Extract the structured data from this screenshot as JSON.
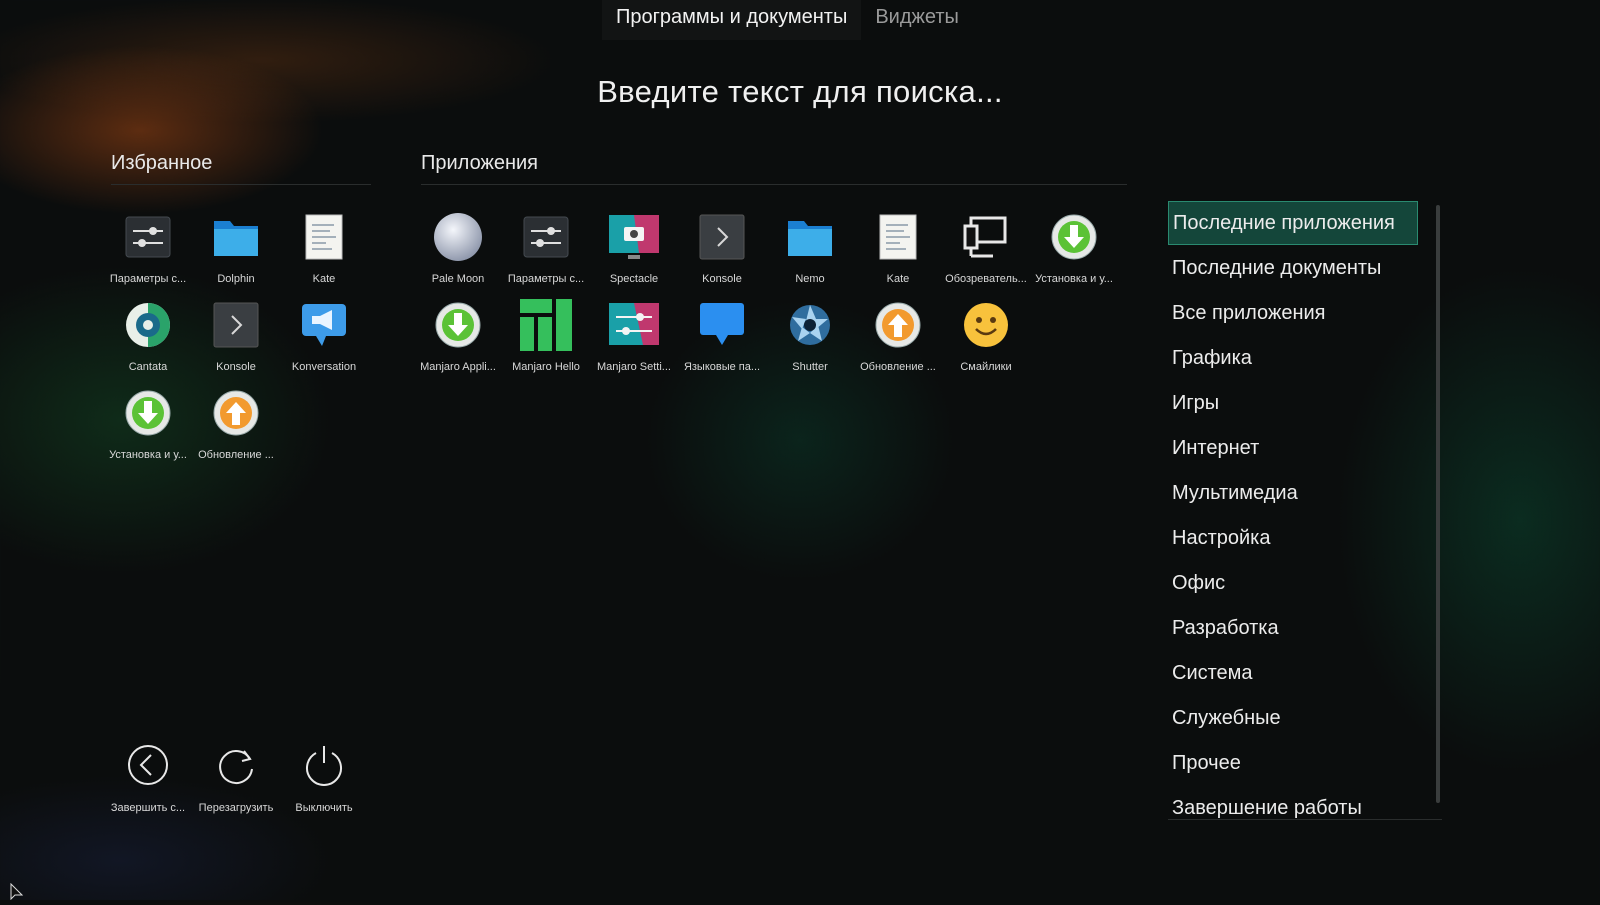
{
  "tabs": [
    {
      "label": "Программы и документы",
      "active": true
    },
    {
      "label": "Виджеты",
      "active": false
    }
  ],
  "search": {
    "placeholder": "Введите текст для поиска..."
  },
  "favorites": {
    "title": "Избранное",
    "items": [
      {
        "label": "Параметры с...",
        "icon": "settings-icon"
      },
      {
        "label": "Dolphin",
        "icon": "folder-icon"
      },
      {
        "label": "Kate",
        "icon": "text-editor-icon"
      },
      {
        "label": "Cantata",
        "icon": "music-player-icon"
      },
      {
        "label": "Konsole",
        "icon": "terminal-icon"
      },
      {
        "label": "Konversation",
        "icon": "chat-megaphone-icon"
      },
      {
        "label": "Установка и у...",
        "icon": "install-download-icon"
      },
      {
        "label": "Обновление ...",
        "icon": "update-upload-icon"
      }
    ]
  },
  "applications": {
    "title": "Приложения",
    "items": [
      {
        "label": "Pale Moon",
        "icon": "pale-moon-icon"
      },
      {
        "label": "Параметры с...",
        "icon": "settings-icon"
      },
      {
        "label": "Spectacle",
        "icon": "screenshot-icon"
      },
      {
        "label": "Konsole",
        "icon": "terminal-icon"
      },
      {
        "label": "Nemo",
        "icon": "folder-icon"
      },
      {
        "label": "Kate",
        "icon": "text-editor-icon"
      },
      {
        "label": "Обозреватель...",
        "icon": "network-icon"
      },
      {
        "label": "Установка и у...",
        "icon": "install-download-icon"
      },
      {
        "label": "Manjaro Appli...",
        "icon": "install-download-icon"
      },
      {
        "label": "Manjaro Hello",
        "icon": "manjaro-logo-icon"
      },
      {
        "label": "Manjaro Setti...",
        "icon": "manjaro-settings-icon"
      },
      {
        "label": "Языковые па...",
        "icon": "language-chat-icon"
      },
      {
        "label": "Shutter",
        "icon": "shutter-aperture-icon"
      },
      {
        "label": "Обновление ...",
        "icon": "update-upload-icon"
      },
      {
        "label": "Смайлики",
        "icon": "smiley-icon"
      }
    ]
  },
  "power": [
    {
      "label": "Завершить с...",
      "icon": "logout-arrow-icon"
    },
    {
      "label": "Перезагрузить",
      "icon": "restart-icon"
    },
    {
      "label": "Выключить",
      "icon": "power-icon"
    }
  ],
  "categories": [
    {
      "label": "Последние приложения",
      "selected": true
    },
    {
      "label": "Последние документы",
      "selected": false
    },
    {
      "label": "Все приложения",
      "selected": false
    },
    {
      "label": "Графика",
      "selected": false
    },
    {
      "label": "Игры",
      "selected": false
    },
    {
      "label": "Интернет",
      "selected": false
    },
    {
      "label": "Мультимедиа",
      "selected": false
    },
    {
      "label": "Настройка",
      "selected": false
    },
    {
      "label": "Офис",
      "selected": false
    },
    {
      "label": "Разработка",
      "selected": false
    },
    {
      "label": "Система",
      "selected": false
    },
    {
      "label": "Служебные",
      "selected": false
    },
    {
      "label": "Прочее",
      "selected": false
    },
    {
      "label": "Завершение работы",
      "selected": false
    }
  ],
  "colors": {
    "accent": "#14463a",
    "accent_border": "#2a8a70",
    "background": "#0b0d0d"
  }
}
